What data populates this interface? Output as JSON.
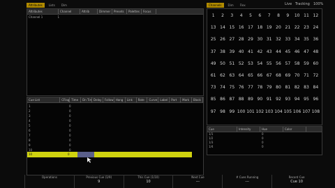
{
  "main_tabs": [
    "Attributes",
    "Lists",
    "Dim"
  ],
  "sheet_headers": [
    "Attributes",
    "Channel",
    "Attrib",
    "Dimmer",
    "Presets",
    "Palettes",
    "Focus"
  ],
  "sheet_rows": [
    [
      "Channel 1",
      "1"
    ]
  ],
  "cue_tabs": [
    "Cue List",
    "CFlag",
    "Time",
    "Dn Time",
    "Delay",
    "Follow",
    "Hang",
    "Link",
    "Rate",
    "Curve",
    "Label",
    "Part",
    "Mark",
    "Block"
  ],
  "cue_rows": [
    [
      "1",
      "0"
    ],
    [
      "2",
      "0"
    ],
    [
      "3",
      "0"
    ],
    [
      "4",
      "0"
    ],
    [
      "5",
      "0"
    ],
    [
      "6",
      "0"
    ],
    [
      "7",
      "0"
    ],
    [
      "8",
      "0"
    ],
    [
      "9",
      "0"
    ],
    [
      "10",
      "0"
    ]
  ],
  "active_cue": {
    "number": "10",
    "value": "0"
  },
  "right_tabs": [
    "Channels",
    "Dim",
    "Flex"
  ],
  "top_right": {
    "live": "Live",
    "mode": "Tracking",
    "pct": "100%"
  },
  "channel_rows": [
    [
      "1",
      "2",
      "3",
      "4",
      "5",
      "6",
      "7",
      "8",
      "9",
      "10",
      "11",
      "12"
    ],
    [
      "13",
      "14",
      "15",
      "16",
      "17",
      "18",
      "19",
      "20",
      "21",
      "22",
      "23",
      "24"
    ],
    [
      "25",
      "26",
      "27",
      "28",
      "29",
      "30",
      "31",
      "32",
      "33",
      "34",
      "35",
      "36"
    ],
    [
      "37",
      "38",
      "39",
      "40",
      "41",
      "42",
      "43",
      "44",
      "45",
      "46",
      "47",
      "48"
    ],
    [
      "49",
      "50",
      "51",
      "52",
      "53",
      "54",
      "55",
      "56",
      "57",
      "58",
      "59",
      "60"
    ],
    [
      "61",
      "62",
      "63",
      "64",
      "65",
      "66",
      "67",
      "68",
      "69",
      "70",
      "71",
      "72"
    ],
    [
      "73",
      "74",
      "75",
      "76",
      "77",
      "78",
      "79",
      "80",
      "81",
      "82",
      "83",
      "84"
    ],
    [
      "85",
      "86",
      "87",
      "88",
      "89",
      "90",
      "91",
      "92",
      "93",
      "94",
      "95",
      "96"
    ],
    [
      "97",
      "98",
      "99",
      "100",
      "101",
      "102",
      "103",
      "104",
      "105",
      "106",
      "107",
      "108"
    ]
  ],
  "list_headers": [
    "Cue",
    "Intensity",
    "Hue",
    "Color"
  ],
  "list_rows": [
    [
      "1/1",
      "0"
    ],
    [
      "1/2",
      "0"
    ],
    [
      "1/3",
      "0"
    ],
    [
      "1/4",
      "0"
    ]
  ],
  "bottom": [
    {
      "label": "Operations",
      "value": ""
    },
    {
      "label": "Previous Cue (1/9)",
      "value": "9"
    },
    {
      "label": "This Cue (1/10)",
      "value": "10"
    },
    {
      "label": "Next Cue",
      "value": "---"
    },
    {
      "label": "# Cues Running",
      "value": "---"
    },
    {
      "label": "Record Cue",
      "value": "Cue 10"
    }
  ]
}
